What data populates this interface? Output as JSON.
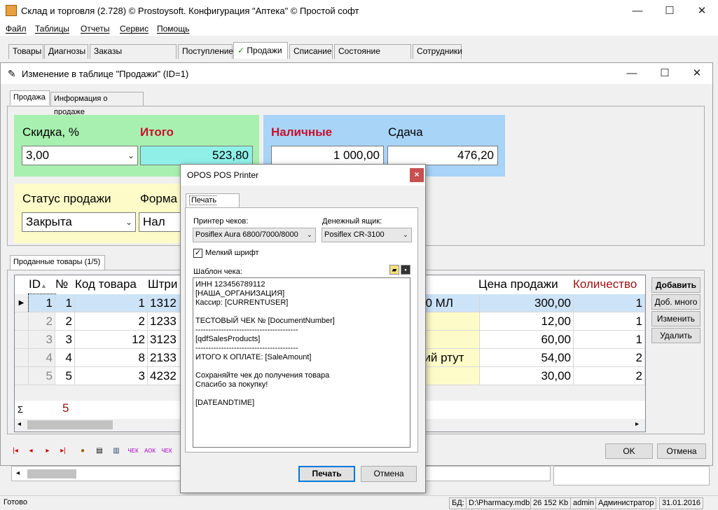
{
  "app": {
    "title": "Склад и торговля (2.728) © Prostoysoft. Конфигурация \"Аптека\" © Простой софт",
    "window_controls": {
      "min": "—",
      "max": "☐",
      "close": "✕"
    }
  },
  "menu": [
    "Файл",
    "Таблицы",
    "Отчеты",
    "Сервис",
    "Помощь"
  ],
  "main_tabs": [
    "Товары",
    "Диагнозы",
    "Заказы поставщикам",
    "Поступление",
    "Продажи",
    "Списание",
    "Состояние складов",
    "Сотрудники"
  ],
  "main_tab_check": "✓",
  "child": {
    "title": "Изменение в таблице \"Продажи\" (ID=1)",
    "tabs": [
      "Продажа",
      "Информация о продаже"
    ],
    "discount_label": "Скидка, %",
    "discount_value": "3,00",
    "total_label": "Итого",
    "total_value": "523,80",
    "cash_label": "Наличные",
    "cash_value": "1 000,00",
    "change_label": "Сдача",
    "change_value": "476,20",
    "status_label": "Статус продажи",
    "status_value": "Закрыта",
    "payment_label": "Форма",
    "payment_value": "Нал",
    "sold_tab": "Проданные товары (1/5)",
    "grid_headers": {
      "id": "ID",
      "num": "№",
      "code": "Код товара",
      "barcode": "Штри",
      "price": "Цена продажи",
      "qty": "Количество"
    },
    "rows": [
      {
        "id": "1",
        "num": "1",
        "code": "1",
        "barcode": "1312",
        "name": "50 МЛ",
        "price": "300,00",
        "qty": "1"
      },
      {
        "id": "2",
        "num": "2",
        "code": "2",
        "barcode": "1233",
        "name": "",
        "price": "12,00",
        "qty": "1"
      },
      {
        "id": "3",
        "num": "3",
        "code": "12",
        "barcode": "3123",
        "name": "",
        "price": "60,00",
        "qty": "1"
      },
      {
        "id": "4",
        "num": "4",
        "code": "8",
        "barcode": "2133",
        "name": "кий ртут",
        "price": "54,00",
        "qty": "2"
      },
      {
        "id": "5",
        "num": "5",
        "code": "3",
        "barcode": "4232",
        "name": "",
        "price": "30,00",
        "qty": "2"
      }
    ],
    "sum_symbol": "Σ",
    "sum_count": "5",
    "side_buttons": [
      "Добавить",
      "Доб. много",
      "Изменить",
      "Удалить"
    ],
    "ok_label": "OK",
    "cancel_label": "Отмена"
  },
  "dialog": {
    "title": "OPOS POS Printer",
    "close": "×",
    "tab": "Печать чека",
    "printer_label": "Принтер чеков:",
    "printer_value": "Posiflex Aura 6800/7000/8000",
    "drawer_label": "Денежный ящик:",
    "drawer_value": "Posiflex CR-3100",
    "small_font_label": "Мелкий шрифт",
    "small_font_checked": true,
    "template_label": "Шаблон чека:",
    "template_lines": [
      "ИНН 123456789112",
      "[НАША_ОРГАНИЗАЦИЯ]",
      "Кассир: [CURRENTUSER]",
      "",
      "ТЕСТОВЫЙ ЧЕК № [DocumentNumber]",
      "----------------------------------------",
      "[qdfSalesProducts]",
      "----------------------------------------",
      "ИТОГО К ОПЛАТЕ: [SaleAmount]",
      "",
      "Сохраняйте чек до получения товара",
      "Спасибо за покупку!",
      "",
      "[DATEANDTIME]"
    ],
    "print_label": "Печать",
    "cancel_label": "Отмена"
  },
  "status": {
    "left": "Готово",
    "db_label": "БД:",
    "db_path": "D:\\Pharmacy.mdb",
    "db_size": "26 152 Kb",
    "user": "admin",
    "role": "Администратор",
    "date": "31.01.2016"
  }
}
